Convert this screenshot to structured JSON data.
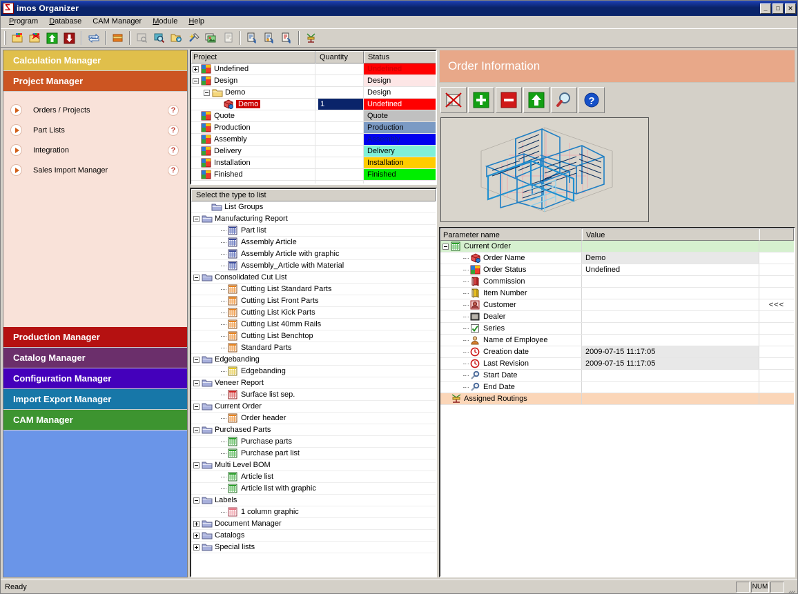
{
  "window": {
    "title": "imos Organizer",
    "icon": "app-logo-icon",
    "minimize": "_",
    "maximize": "□",
    "close": "✕"
  },
  "menu": {
    "items": [
      {
        "label": "Program",
        "accel": "P"
      },
      {
        "label": "Database",
        "accel": "D"
      },
      {
        "label": "CAM Manager",
        "accel": ""
      },
      {
        "label": "Module",
        "accel": "M"
      },
      {
        "label": "Help",
        "accel": "H"
      }
    ]
  },
  "toolbar": {
    "buttons": [
      {
        "name": "new-order-icon",
        "tip": "New Order"
      },
      {
        "name": "open-order-icon",
        "tip": "Open Order"
      },
      {
        "name": "upload-green-arrow-icon",
        "tip": "Check In"
      },
      {
        "name": "download-red-arrow-icon",
        "tip": "Check Out"
      },
      {
        "name": "exchange-arrows-icon",
        "tip": "Exchange"
      },
      {
        "name": "catalog-books-icon",
        "tip": "Catalog"
      },
      {
        "name": "preview-disabled-icon",
        "tip": "Preview"
      },
      {
        "name": "search-zoom-icon",
        "tip": "Find"
      },
      {
        "name": "folder-star-icon",
        "tip": "Favorites"
      },
      {
        "name": "magic-wand-icon",
        "tip": "Wizard"
      },
      {
        "name": "image-green-icon",
        "tip": "Graphic"
      },
      {
        "name": "document-grey-icon",
        "tip": "Document"
      },
      {
        "name": "report-blue-1-icon",
        "tip": "Report"
      },
      {
        "name": "report-blue-2-icon",
        "tip": "Report"
      },
      {
        "name": "report-red-icon",
        "tip": "Report"
      },
      {
        "name": "routing-icon",
        "tip": "Routing"
      }
    ]
  },
  "sidebar": {
    "bands": [
      {
        "label": "Calculation Manager",
        "color": "#e0bf4b",
        "name": "calculation-manager"
      },
      {
        "label": "Project Manager",
        "color": "#cc5522",
        "name": "project-manager"
      }
    ],
    "items": [
      {
        "label": "Orders / Projects",
        "help": "?"
      },
      {
        "label": "Part Lists",
        "help": "?"
      },
      {
        "label": "Integration",
        "help": "?"
      },
      {
        "label": "Sales Import Manager",
        "help": "?"
      }
    ],
    "bands_bottom": [
      {
        "label": "Production Manager",
        "color": "#b51111",
        "name": "production-manager"
      },
      {
        "label": "Catalog Manager",
        "color": "#6b2f6b",
        "name": "catalog-manager"
      },
      {
        "label": "Configuration Manager",
        "color": "#4400bb",
        "name": "configuration-manager"
      },
      {
        "label": "Import Export Manager",
        "color": "#1777a8",
        "name": "import-export-manager"
      },
      {
        "label": "CAM Manager",
        "color": "#3d9430",
        "name": "cam-manager"
      }
    ]
  },
  "project_grid": {
    "columns": [
      "Project",
      "Quantity",
      "Status"
    ],
    "rows": [
      {
        "label": "Undefined",
        "quantity": "",
        "status": "Undefined",
        "status_bg": "#ff0000",
        "status_fg": "#cc0000",
        "indent": 0,
        "toggle": "plus",
        "icon": "project-colored-icon",
        "selected": false
      },
      {
        "label": "Design",
        "quantity": "",
        "status": "Design",
        "status_bg": "#fde6e6",
        "status_fg": "#000000",
        "indent": 0,
        "toggle": "minus",
        "icon": "project-colored-icon",
        "selected": false
      },
      {
        "label": "Demo",
        "quantity": "",
        "status": "Design",
        "status_bg": "#ffffff",
        "status_fg": "#000000",
        "indent": 1,
        "toggle": "minus",
        "icon": "folder-yellow-icon",
        "selected": false
      },
      {
        "label": "Demo",
        "quantity": "1",
        "status": "Undefined",
        "status_bg": "#ff0000",
        "status_fg": "#ffffff",
        "indent": 2,
        "toggle": "none",
        "icon": "order-cube-icon",
        "selected": true
      },
      {
        "label": "Quote",
        "quantity": "",
        "status": "Quote",
        "status_bg": "#c0c0c0",
        "status_fg": "#000000",
        "indent": 0,
        "toggle": "none",
        "icon": "project-colored-icon",
        "selected": false
      },
      {
        "label": "Production",
        "quantity": "",
        "status": "Production",
        "status_bg": "#7b9ac4",
        "status_fg": "#000000",
        "indent": 0,
        "toggle": "none",
        "icon": "project-colored-icon",
        "selected": false
      },
      {
        "label": "Assembly",
        "quantity": "",
        "status": "Assembly",
        "status_bg": "#0000ee",
        "status_fg": "#0a1a8a",
        "indent": 0,
        "toggle": "none",
        "icon": "project-colored-icon",
        "selected": false
      },
      {
        "label": "Delivery",
        "quantity": "",
        "status": "Delivery",
        "status_bg": "#7ff0d8",
        "status_fg": "#000000",
        "indent": 0,
        "toggle": "none",
        "icon": "project-colored-icon",
        "selected": false
      },
      {
        "label": "Installation",
        "quantity": "",
        "status": "Installation",
        "status_bg": "#ffcc00",
        "status_fg": "#000000",
        "indent": 0,
        "toggle": "none",
        "icon": "project-colored-icon",
        "selected": false
      },
      {
        "label": "Finished",
        "quantity": "",
        "status": "Finished",
        "status_bg": "#00ee00",
        "status_fg": "#000000",
        "indent": 0,
        "toggle": "none",
        "icon": "project-colored-icon",
        "selected": false
      }
    ]
  },
  "list_tree": {
    "header": "Select the type to list",
    "rows": [
      {
        "label": "List Groups",
        "indent": 1,
        "toggle": "none",
        "icon": "folder-blue-icon"
      },
      {
        "label": "Manufacturing Report",
        "indent": 0,
        "toggle": "minus",
        "icon": "folder-blue-icon"
      },
      {
        "label": "Part list",
        "indent": 2,
        "toggle": "none",
        "icon": "list-blue-icon"
      },
      {
        "label": "Assembly Article",
        "indent": 2,
        "toggle": "none",
        "icon": "list-blue-icon"
      },
      {
        "label": "Assembly Article with graphic",
        "indent": 2,
        "toggle": "none",
        "icon": "list-blue-icon"
      },
      {
        "label": "Assembly_Article with Material",
        "indent": 2,
        "toggle": "none",
        "icon": "list-blue-icon"
      },
      {
        "label": "Consolidated Cut List",
        "indent": 0,
        "toggle": "minus",
        "icon": "folder-blue-icon"
      },
      {
        "label": "Cutting List Standard Parts",
        "indent": 2,
        "toggle": "none",
        "icon": "list-orange-icon"
      },
      {
        "label": "Cutting List Front Parts",
        "indent": 2,
        "toggle": "none",
        "icon": "list-orange-icon"
      },
      {
        "label": "Cutting List Kick Parts",
        "indent": 2,
        "toggle": "none",
        "icon": "list-orange-icon"
      },
      {
        "label": "Cutting List 40mm Rails",
        "indent": 2,
        "toggle": "none",
        "icon": "list-orange-icon"
      },
      {
        "label": "Cutting List Benchtop",
        "indent": 2,
        "toggle": "none",
        "icon": "list-orange-icon"
      },
      {
        "label": "Standard Parts",
        "indent": 2,
        "toggle": "none",
        "icon": "list-orange-icon"
      },
      {
        "label": "Edgebanding",
        "indent": 0,
        "toggle": "minus",
        "icon": "folder-blue-icon"
      },
      {
        "label": "Edgebanding",
        "indent": 2,
        "toggle": "none",
        "icon": "list-yellow-icon"
      },
      {
        "label": "Veneer Report",
        "indent": 0,
        "toggle": "minus",
        "icon": "folder-blue-icon"
      },
      {
        "label": "Surface list sep.",
        "indent": 2,
        "toggle": "none",
        "icon": "list-red-icon"
      },
      {
        "label": "Current Order",
        "indent": 0,
        "toggle": "minus",
        "icon": "folder-blue-icon"
      },
      {
        "label": "Order header",
        "indent": 2,
        "toggle": "none",
        "icon": "list-orange-icon"
      },
      {
        "label": "Purchased Parts",
        "indent": 0,
        "toggle": "minus",
        "icon": "folder-blue-icon"
      },
      {
        "label": "Purchase parts",
        "indent": 2,
        "toggle": "none",
        "icon": "list-green-icon"
      },
      {
        "label": "Purchase part list",
        "indent": 2,
        "toggle": "none",
        "icon": "list-green-icon"
      },
      {
        "label": "Multi Level BOM",
        "indent": 0,
        "toggle": "minus",
        "icon": "folder-blue-icon"
      },
      {
        "label": "Article list",
        "indent": 2,
        "toggle": "none",
        "icon": "list-green-icon"
      },
      {
        "label": "Article list with graphic",
        "indent": 2,
        "toggle": "none",
        "icon": "list-green-icon"
      },
      {
        "label": "Labels",
        "indent": 0,
        "toggle": "minus",
        "icon": "folder-blue-icon"
      },
      {
        "label": "1 column graphic",
        "indent": 2,
        "toggle": "none",
        "icon": "list-pink-icon"
      },
      {
        "label": "Document Manager",
        "indent": 0,
        "toggle": "plus",
        "icon": "folder-blue-icon"
      },
      {
        "label": "Catalogs",
        "indent": 0,
        "toggle": "plus",
        "icon": "folder-blue-icon"
      },
      {
        "label": "Special lists",
        "indent": 0,
        "toggle": "plus",
        "icon": "folder-blue-icon"
      }
    ]
  },
  "order_info": {
    "title": "Order Information",
    "header_color": "#e8a889",
    "buttons": [
      {
        "name": "delete-order-icon",
        "tip": "Delete"
      },
      {
        "name": "add-plus-icon",
        "tip": "Add"
      },
      {
        "name": "remove-minus-icon",
        "tip": "Remove"
      },
      {
        "name": "up-arrow-icon",
        "tip": "Move Up"
      },
      {
        "name": "magnifier-icon",
        "tip": "Zoom"
      },
      {
        "name": "help-question-icon",
        "tip": "Help"
      }
    ],
    "preview_alt": "3D wireframe CAD preview of cabinetry assembly"
  },
  "params": {
    "columns": [
      "Parameter name",
      "Value",
      ""
    ],
    "rows": [
      {
        "name": "Current Order",
        "value": "",
        "extra": "",
        "indent": 0,
        "toggle": "minus",
        "icon": "list-green-icon",
        "style": "hdr"
      },
      {
        "name": "Order Name",
        "value": "Demo",
        "extra": "",
        "indent": 1,
        "toggle": "none",
        "icon": "order-cube-icon",
        "style": "shade"
      },
      {
        "name": "Order Status",
        "value": "Undefined",
        "extra": "",
        "indent": 1,
        "toggle": "none",
        "icon": "project-colored-icon",
        "style": ""
      },
      {
        "name": "Commission",
        "value": "",
        "extra": "",
        "indent": 1,
        "toggle": "none",
        "icon": "commission-book-icon",
        "style": ""
      },
      {
        "name": "Item Number",
        "value": "",
        "extra": "",
        "indent": 1,
        "toggle": "none",
        "icon": "item-number-icon",
        "style": ""
      },
      {
        "name": "Customer",
        "value": "",
        "extra": "<<<",
        "indent": 1,
        "toggle": "none",
        "icon": "customer-icon",
        "style": ""
      },
      {
        "name": "Dealer",
        "value": "",
        "extra": "",
        "indent": 1,
        "toggle": "none",
        "icon": "dealer-icon",
        "style": ""
      },
      {
        "name": "Series",
        "value": "",
        "extra": "",
        "indent": 1,
        "toggle": "none",
        "icon": "series-check-icon",
        "style": ""
      },
      {
        "name": "Name of Employee",
        "value": "",
        "extra": "",
        "indent": 1,
        "toggle": "none",
        "icon": "employee-icon",
        "style": ""
      },
      {
        "name": "Creation date",
        "value": "2009-07-15 11:17:05",
        "extra": "",
        "indent": 1,
        "toggle": "none",
        "icon": "clock-red-icon",
        "style": "shade"
      },
      {
        "name": "Last Revision",
        "value": "2009-07-15 11:17:05",
        "extra": "",
        "indent": 1,
        "toggle": "none",
        "icon": "clock-red-icon",
        "style": "shade"
      },
      {
        "name": "Start Date",
        "value": "",
        "extra": "",
        "indent": 1,
        "toggle": "none",
        "icon": "wrench-icon",
        "style": ""
      },
      {
        "name": "End Date",
        "value": "",
        "extra": "",
        "indent": 1,
        "toggle": "none",
        "icon": "wrench-icon",
        "style": ""
      },
      {
        "name": "Assigned Routings",
        "value": "",
        "extra": "",
        "indent": 0,
        "toggle": "none",
        "icon": "routing-icon",
        "style": "routing"
      }
    ]
  },
  "statusbar": {
    "message": "Ready",
    "pane1": "",
    "num": "NUM",
    "pane3": ""
  }
}
